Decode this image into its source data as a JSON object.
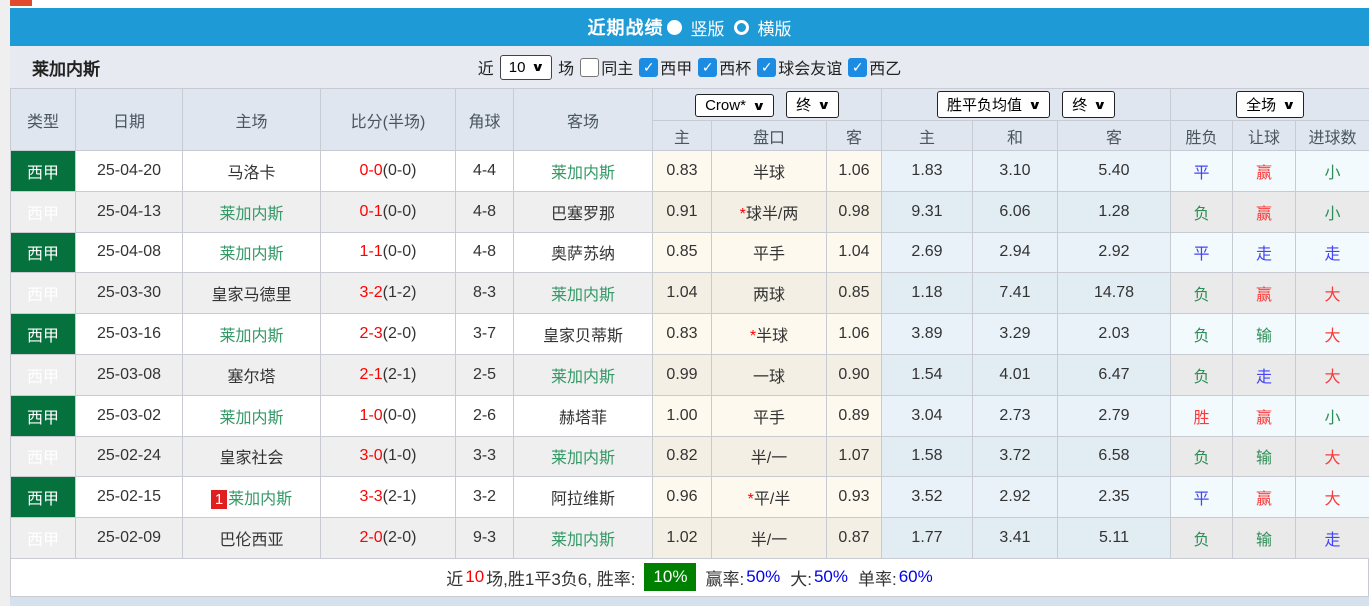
{
  "titlebar": {
    "title": "近期战绩",
    "radio_selected_label": "竖版",
    "radio_unselected_label": "横版"
  },
  "filterbar": {
    "team": "莱加内斯",
    "near_label": "近",
    "matches_select": "10",
    "matches_label": "场",
    "checks": [
      {
        "label": "同主",
        "checked": false
      },
      {
        "label": "西甲",
        "checked": true
      },
      {
        "label": "西杯",
        "checked": true
      },
      {
        "label": "球会友谊",
        "checked": true
      },
      {
        "label": "西乙",
        "checked": true
      }
    ]
  },
  "table": {
    "main_headers": [
      "类型",
      "日期",
      "主场",
      "比分(半场)",
      "角球",
      "客场"
    ],
    "dropdowns": {
      "ah_company": "Crow*",
      "ah_time": "终",
      "avg_name": "胜平负均值",
      "avg_time": "终",
      "scope": "全场"
    },
    "sub_headers": [
      "主",
      "盘口",
      "客",
      "主",
      "和",
      "客",
      "胜负",
      "让球",
      "进球数"
    ]
  },
  "result_colors": {
    "胜": "red",
    "平": "blue",
    "负": "green",
    "赢": "red",
    "输": "green",
    "走": "blue",
    "大": "red",
    "小": "green"
  },
  "rows": [
    {
      "league": "西甲",
      "date": "25-04-20",
      "home": "马洛卡",
      "home_is_focus": false,
      "home_badge": "",
      "score": "0-0",
      "half": "(0-0)",
      "corners": "4-4",
      "away": "莱加内斯",
      "away_is_focus": true,
      "ah_home": "0.83",
      "ah_star": false,
      "ah_line": "半球",
      "ah_away": "1.06",
      "avg_home": "1.83",
      "avg_draw": "3.10",
      "avg_away": "5.40",
      "res_wdl": "平",
      "res_ah": "赢",
      "res_goal": "小"
    },
    {
      "league": "西甲",
      "date": "25-04-13",
      "home": "莱加内斯",
      "home_is_focus": true,
      "home_badge": "",
      "score": "0-1",
      "half": "(0-0)",
      "corners": "4-8",
      "away": "巴塞罗那",
      "away_is_focus": false,
      "ah_home": "0.91",
      "ah_star": true,
      "ah_line": "球半/两",
      "ah_away": "0.98",
      "avg_home": "9.31",
      "avg_draw": "6.06",
      "avg_away": "1.28",
      "res_wdl": "负",
      "res_ah": "赢",
      "res_goal": "小"
    },
    {
      "league": "西甲",
      "date": "25-04-08",
      "home": "莱加内斯",
      "home_is_focus": true,
      "home_badge": "",
      "score": "1-1",
      "half": "(0-0)",
      "corners": "4-8",
      "away": "奥萨苏纳",
      "away_is_focus": false,
      "ah_home": "0.85",
      "ah_star": false,
      "ah_line": "平手",
      "ah_away": "1.04",
      "avg_home": "2.69",
      "avg_draw": "2.94",
      "avg_away": "2.92",
      "res_wdl": "平",
      "res_ah": "走",
      "res_goal": "走"
    },
    {
      "league": "西甲",
      "date": "25-03-30",
      "home": "皇家马德里",
      "home_is_focus": false,
      "home_badge": "",
      "score": "3-2",
      "half": "(1-2)",
      "corners": "8-3",
      "away": "莱加内斯",
      "away_is_focus": true,
      "ah_home": "1.04",
      "ah_star": false,
      "ah_line": "两球",
      "ah_away": "0.85",
      "avg_home": "1.18",
      "avg_draw": "7.41",
      "avg_away": "14.78",
      "res_wdl": "负",
      "res_ah": "赢",
      "res_goal": "大"
    },
    {
      "league": "西甲",
      "date": "25-03-16",
      "home": "莱加内斯",
      "home_is_focus": true,
      "home_badge": "",
      "score": "2-3",
      "half": "(2-0)",
      "corners": "3-7",
      "away": "皇家贝蒂斯",
      "away_is_focus": false,
      "ah_home": "0.83",
      "ah_star": true,
      "ah_line": "半球",
      "ah_away": "1.06",
      "avg_home": "3.89",
      "avg_draw": "3.29",
      "avg_away": "2.03",
      "res_wdl": "负",
      "res_ah": "输",
      "res_goal": "大"
    },
    {
      "league": "西甲",
      "date": "25-03-08",
      "home": "塞尔塔",
      "home_is_focus": false,
      "home_badge": "",
      "score": "2-1",
      "half": "(2-1)",
      "corners": "2-5",
      "away": "莱加内斯",
      "away_is_focus": true,
      "ah_home": "0.99",
      "ah_star": false,
      "ah_line": "一球",
      "ah_away": "0.90",
      "avg_home": "1.54",
      "avg_draw": "4.01",
      "avg_away": "6.47",
      "res_wdl": "负",
      "res_ah": "走",
      "res_goal": "大"
    },
    {
      "league": "西甲",
      "date": "25-03-02",
      "home": "莱加内斯",
      "home_is_focus": true,
      "home_badge": "",
      "score": "1-0",
      "half": "(0-0)",
      "corners": "2-6",
      "away": "赫塔菲",
      "away_is_focus": false,
      "ah_home": "1.00",
      "ah_star": false,
      "ah_line": "平手",
      "ah_away": "0.89",
      "avg_home": "3.04",
      "avg_draw": "2.73",
      "avg_away": "2.79",
      "res_wdl": "胜",
      "res_ah": "赢",
      "res_goal": "小"
    },
    {
      "league": "西甲",
      "date": "25-02-24",
      "home": "皇家社会",
      "home_is_focus": false,
      "home_badge": "",
      "score": "3-0",
      "half": "(1-0)",
      "corners": "3-3",
      "away": "莱加内斯",
      "away_is_focus": true,
      "ah_home": "0.82",
      "ah_star": false,
      "ah_line": "半/一",
      "ah_away": "1.07",
      "avg_home": "1.58",
      "avg_draw": "3.72",
      "avg_away": "6.58",
      "res_wdl": "负",
      "res_ah": "输",
      "res_goal": "大"
    },
    {
      "league": "西甲",
      "date": "25-02-15",
      "home": "莱加内斯",
      "home_is_focus": true,
      "home_badge": "1",
      "score": "3-3",
      "half": "(2-1)",
      "corners": "3-2",
      "away": "阿拉维斯",
      "away_is_focus": false,
      "ah_home": "0.96",
      "ah_star": true,
      "ah_line": "平/半",
      "ah_away": "0.93",
      "avg_home": "3.52",
      "avg_draw": "2.92",
      "avg_away": "2.35",
      "res_wdl": "平",
      "res_ah": "赢",
      "res_goal": "大"
    },
    {
      "league": "西甲",
      "date": "25-02-09",
      "home": "巴伦西亚",
      "home_is_focus": false,
      "home_badge": "",
      "score": "2-0",
      "half": "(2-0)",
      "corners": "9-3",
      "away": "莱加内斯",
      "away_is_focus": true,
      "ah_home": "1.02",
      "ah_star": false,
      "ah_line": "半/一",
      "ah_away": "0.87",
      "avg_home": "1.77",
      "avg_draw": "3.41",
      "avg_away": "5.11",
      "res_wdl": "负",
      "res_ah": "输",
      "res_goal": "走"
    }
  ],
  "footer": {
    "near_label": "近",
    "near_count": "10",
    "summary": "场,胜1平3负6, 胜率:",
    "win_rate": "10%",
    "win_label": "赢率:",
    "win_pct": "50%",
    "big_label": "大:",
    "big_pct": "50%",
    "single_label": "单率:",
    "single_pct": "60%"
  },
  "colors": {
    "titlebar_blue": "#1e9ad6",
    "badge_green": "#05713c",
    "focus_team_green": "#339966",
    "score_red": "#ff0000",
    "result_red": "#fb3b3b",
    "result_green": "#2f8e57",
    "result_blue": "#4444f5",
    "rate_box_green": "#008000",
    "pct_blue": "#0000ee",
    "checkbox_blue": "#1b8ce2"
  }
}
